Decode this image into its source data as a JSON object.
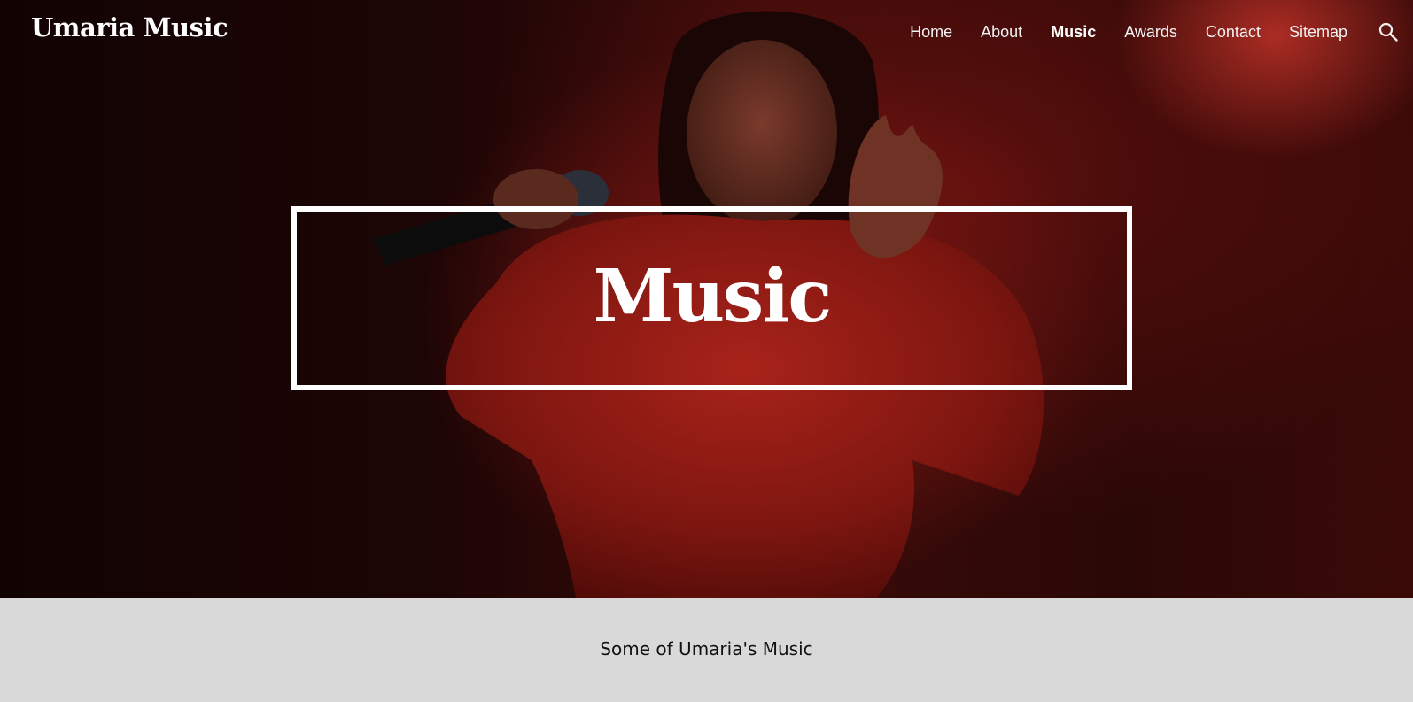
{
  "site": {
    "brand": "Umaria Music"
  },
  "nav": {
    "items": [
      {
        "label": "Home",
        "active": false
      },
      {
        "label": "About",
        "active": false
      },
      {
        "label": "Music",
        "active": true
      },
      {
        "label": "Awards",
        "active": false
      },
      {
        "label": "Contact",
        "active": false
      },
      {
        "label": "Sitemap",
        "active": false
      }
    ],
    "search_icon": "search-icon"
  },
  "hero": {
    "title": "Music",
    "image": "performer-singing-with-microphone-red-stage"
  },
  "content": {
    "heading": "Some of Umaria's Music"
  },
  "colors": {
    "hero_dark": "#1c0505",
    "hero_red": "#8e1a14",
    "content_bg": "#d9d9d9",
    "text_light": "#ffffff",
    "text_dark": "#111111"
  }
}
